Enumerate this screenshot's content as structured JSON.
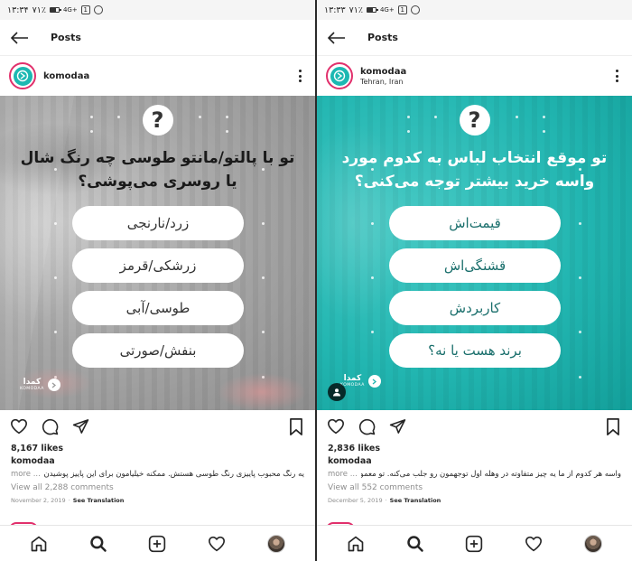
{
  "statusbar": {
    "left": {
      "time": "۱۳:۳۴",
      "battery": "۷۱٪"
    },
    "right": {
      "time": "۱۳:۳۳",
      "battery": "۷۱٪"
    },
    "network": "4G+"
  },
  "topbar": {
    "title": "Posts"
  },
  "posts": [
    {
      "username": "komodaa",
      "location": "",
      "question": "تو با پالتو/مانتو طوسی چه رنگ شال یا روسری می‌پوشی؟",
      "options": [
        "زرد/نارنجی",
        "زرشکی/قرمز",
        "طوسی/آبی",
        "بنفش/صورتی"
      ],
      "brand_fa": "کمدا",
      "brand_en": "KOMODAA",
      "likes": "8,167 likes",
      "caption_user": "komodaa",
      "caption_more": "more ...",
      "caption_text": "یه رنگ محبوب پاییزی رنگ طوسی هستش. ممکنه خیلیامون برای این پاییز پوشیدن یه ...",
      "comments": "View all 2,288 comments",
      "date": "November 2, 2019",
      "translation": "See Translation",
      "image_color": "#a8a8a8"
    },
    {
      "username": "komodaa",
      "location": "Tehran, Iran",
      "question": "تو موقع انتخاب لباس به کدوم مورد واسه خرید بیشتر توجه می‌کنی؟",
      "options": [
        "قیمت‌اش",
        "قشنگی‌اش",
        "کاربردش",
        "برند هست یا نه؟"
      ],
      "brand_fa": "کمدا",
      "brand_en": "KOMODAA",
      "likes": "2,836 likes",
      "caption_user": "komodaa",
      "caption_more": "more ...",
      "caption_text": "واسه هر کدوم از ما یه چیز متفاوته در وهله اول توجهمون رو جلب می‌کنه. تو معمولا و ...",
      "comments": "View all 552 comments",
      "date": "December 5, 2019",
      "translation": "See Translation",
      "image_color": "#22b6b1"
    }
  ],
  "colors": {
    "accent": "#1cb8b2",
    "story_ring": "#e1306c",
    "muted": "#8e8e8e"
  },
  "icons": {
    "topbar": [
      "back-arrow-icon"
    ],
    "actions": [
      "heart-icon",
      "comment-icon",
      "share-icon",
      "bookmark-icon"
    ],
    "nav": [
      "home-icon",
      "search-icon",
      "add-post-icon",
      "activity-heart-icon",
      "profile-avatar-icon"
    ]
  }
}
